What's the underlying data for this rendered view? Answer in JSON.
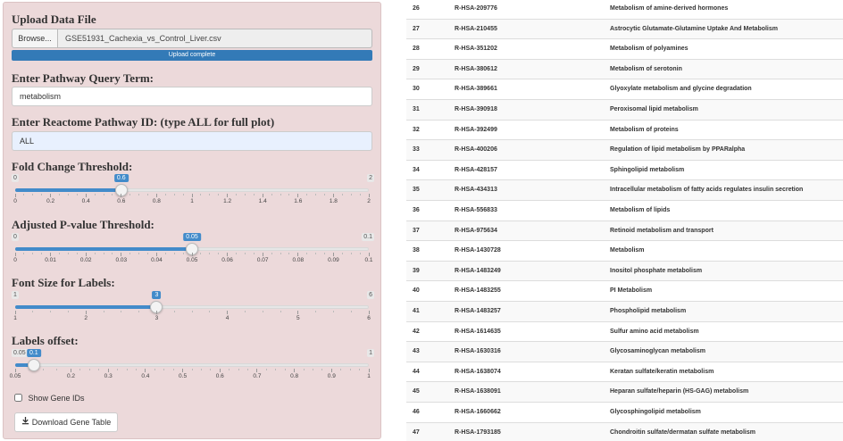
{
  "sidebar": {
    "upload_heading": "Upload Data File",
    "browse_label": "Browse...",
    "file_name": "GSE51931_Cachexia_vs_Control_Liver.csv",
    "upload_status": "Upload complete",
    "upload_progress": 1.0,
    "query_heading": "Enter Pathway Query Term:",
    "query_value": "metabolism",
    "pathway_id_heading": "Enter Reactome Pathway ID: (type ALL for full plot)",
    "pathway_id_value": "ALL",
    "show_gene_ids_label": "Show Gene IDs",
    "show_gene_ids_checked": false,
    "download_label": "Download Gene Table",
    "download_icon": "download-icon"
  },
  "sliders": [
    {
      "key": "fold-change",
      "heading": "Fold Change Threshold:",
      "min": 0,
      "max": 2,
      "value": 0.6,
      "min_label": "0",
      "max_label": "2",
      "value_label": "0.6",
      "major_ticks": [
        0,
        0.2,
        0.4,
        0.6,
        0.8,
        1,
        1.2,
        1.4,
        1.6,
        1.8,
        2
      ],
      "tick_labels": [
        "0",
        "0.2",
        "0.4",
        "0.6",
        "0.8",
        "1",
        "1.2",
        "1.4",
        "1.6",
        "1.8",
        "2"
      ]
    },
    {
      "key": "adj-pvalue",
      "heading": "Adjusted P-value Threshold:",
      "min": 0,
      "max": 0.1,
      "value": 0.05,
      "min_label": "0",
      "max_label": "0.1",
      "value_label": "0.05",
      "major_ticks": [
        0,
        0.01,
        0.02,
        0.03,
        0.04,
        0.05,
        0.06,
        0.07,
        0.08,
        0.09,
        0.1
      ],
      "tick_labels": [
        "0",
        "0.01",
        "0.02",
        "0.03",
        "0.04",
        "0.05",
        "0.06",
        "0.07",
        "0.08",
        "0.09",
        "0.1"
      ]
    },
    {
      "key": "font-size",
      "heading": "Font Size for Labels:",
      "min": 1,
      "max": 6,
      "value": 3,
      "min_label": "1",
      "max_label": "6",
      "value_label": "3",
      "major_ticks": [
        1,
        2,
        3,
        4,
        5,
        6
      ],
      "tick_labels": [
        "1",
        "2",
        "3",
        "4",
        "5",
        "6"
      ]
    },
    {
      "key": "labels-offset",
      "heading": "Labels offset:",
      "min": 0.05,
      "max": 1,
      "value": 0.1,
      "min_label": "0.05",
      "max_label": "1",
      "value_label": "0.1",
      "major_ticks": [
        0.05,
        0.2,
        0.3,
        0.4,
        0.5,
        0.6,
        0.7,
        0.8,
        0.9,
        1
      ],
      "tick_labels": [
        "0.05",
        "0.2",
        "0.3",
        "0.4",
        "0.5",
        "0.6",
        "0.7",
        "0.8",
        "0.9",
        "1"
      ]
    }
  ],
  "table": {
    "rows": [
      [
        "26",
        "R-HSA-209776",
        "Metabolism of amine-derived hormones"
      ],
      [
        "27",
        "R-HSA-210455",
        "Astrocytic Glutamate-Glutamine Uptake And Metabolism"
      ],
      [
        "28",
        "R-HSA-351202",
        "Metabolism of polyamines"
      ],
      [
        "29",
        "R-HSA-380612",
        "Metabolism of serotonin"
      ],
      [
        "30",
        "R-HSA-389661",
        "Glyoxylate metabolism and glycine degradation"
      ],
      [
        "31",
        "R-HSA-390918",
        "Peroxisomal lipid metabolism"
      ],
      [
        "32",
        "R-HSA-392499",
        "Metabolism of proteins"
      ],
      [
        "33",
        "R-HSA-400206",
        "Regulation of lipid metabolism by PPARalpha"
      ],
      [
        "34",
        "R-HSA-428157",
        "Sphingolipid metabolism"
      ],
      [
        "35",
        "R-HSA-434313",
        "Intracellular metabolism of fatty acids regulates insulin secretion"
      ],
      [
        "36",
        "R-HSA-556833",
        "Metabolism of lipids"
      ],
      [
        "37",
        "R-HSA-975634",
        "Retinoid metabolism and transport"
      ],
      [
        "38",
        "R-HSA-1430728",
        "Metabolism"
      ],
      [
        "39",
        "R-HSA-1483249",
        "Inositol phosphate metabolism"
      ],
      [
        "40",
        "R-HSA-1483255",
        "PI Metabolism"
      ],
      [
        "41",
        "R-HSA-1483257",
        "Phospholipid metabolism"
      ],
      [
        "42",
        "R-HSA-1614635",
        "Sulfur amino acid metabolism"
      ],
      [
        "43",
        "R-HSA-1630316",
        "Glycosaminoglycan metabolism"
      ],
      [
        "44",
        "R-HSA-1638074",
        "Keratan sulfate/keratin metabolism"
      ],
      [
        "45",
        "R-HSA-1638091",
        "Heparan sulfate/heparin (HS-GAG) metabolism"
      ],
      [
        "46",
        "R-HSA-1660662",
        "Glycosphingolipid metabolism"
      ],
      [
        "47",
        "R-HSA-1793185",
        "Chondroitin sulfate/dermatan sulfate metabolism"
      ]
    ]
  },
  "colors": {
    "sidebar_bg": "#ecd9da",
    "accent": "#428bca",
    "progress": "#337ab7"
  }
}
